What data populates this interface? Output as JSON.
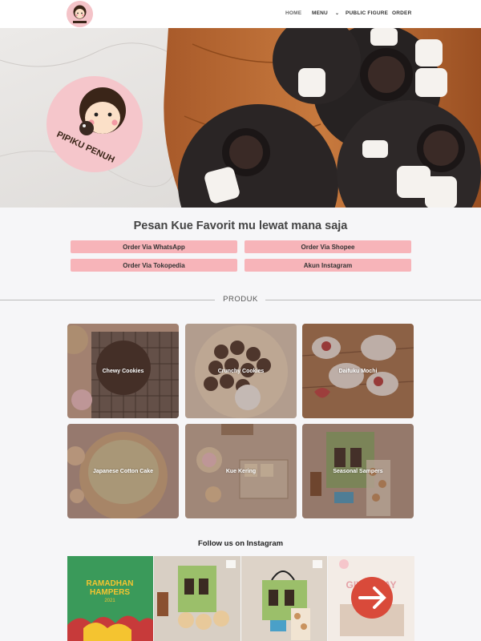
{
  "header": {
    "logo_icon": "pipiku-penuh-logo",
    "nav": {
      "home": "HOME",
      "menu": "MENU",
      "public_figure": "PUBLIC FIGURE",
      "order": "ORDER"
    }
  },
  "hero": {
    "sticker_text": "PIPIKU PENUH"
  },
  "order": {
    "title": "Pesan Kue Favorit mu lewat mana saja",
    "buttons": {
      "whatsapp": "Order Via WhatsApp",
      "shopee": "Order Via Shopee",
      "tokopedia": "Order Via Tokopedia",
      "instagram": "Akun Instagram"
    }
  },
  "produk": {
    "heading": "PRODUK",
    "items": [
      {
        "label": "Chewy Cookies"
      },
      {
        "label": "Crunchy Cookies"
      },
      {
        "label": "Daifuku Mochi"
      },
      {
        "label": "Japanese Cotton Cake"
      },
      {
        "label": "Kue Kering"
      },
      {
        "label": "Seasonal Sampers"
      }
    ]
  },
  "instagram": {
    "title": "Follow us on Instagram",
    "posts": [
      {
        "line1": "RAMADHAN",
        "line2": "HAMPERS",
        "line3": "2021"
      },
      {},
      {},
      {
        "heading": "GIVEAWAY"
      }
    ]
  },
  "colors": {
    "accent_pink": "#f7b4b9",
    "background": "#f6f6f8",
    "ramadhan_green": "#3a9a5a",
    "ramadhan_yellow": "#f4c430"
  }
}
